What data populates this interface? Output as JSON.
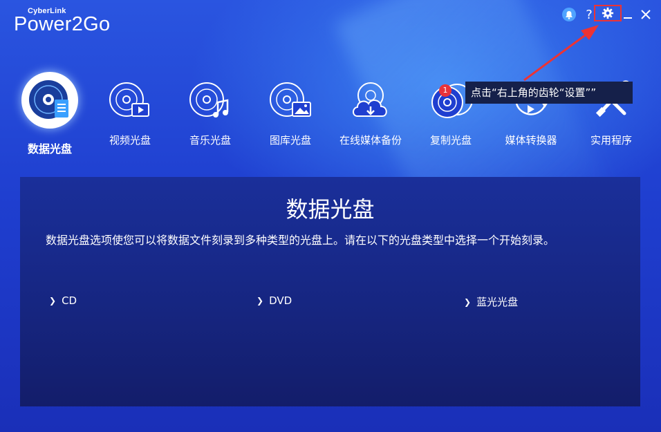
{
  "app": {
    "brand_small": "CyberLink",
    "brand_main": "Power2Go"
  },
  "window_controls": {
    "help": "?",
    "minimize": "_",
    "close": "✕"
  },
  "tooltip": "点击“右上角的齿轮“设置””",
  "nav": {
    "items": [
      {
        "label": "数据光盘",
        "icon": "data-disc-icon",
        "active": true
      },
      {
        "label": "视频光盘",
        "icon": "video-disc-icon"
      },
      {
        "label": "音乐光盘",
        "icon": "music-disc-icon"
      },
      {
        "label": "图库光盘",
        "icon": "photo-disc-icon"
      },
      {
        "label": "在线媒体备份",
        "icon": "cloud-backup-icon"
      },
      {
        "label": "复制光盘",
        "icon": "copy-disc-icon",
        "badge": "1"
      },
      {
        "label": "媒体转换器",
        "icon": "media-converter-icon"
      },
      {
        "label": "实用程序",
        "icon": "utilities-icon"
      }
    ]
  },
  "panel": {
    "title": "数据光盘",
    "description": "数据光盘选项使您可以将数据文件刻录到多种类型的光盘上。请在以下的光盘类型中选择一个开始刻录。",
    "options": [
      {
        "label": "CD"
      },
      {
        "label": "DVD"
      },
      {
        "label": "蓝光光盘"
      }
    ]
  },
  "colors": {
    "accent": "#4fa3ff",
    "highlight_box": "#e33333",
    "badge": "#e8333a",
    "panel": "#16257f"
  }
}
